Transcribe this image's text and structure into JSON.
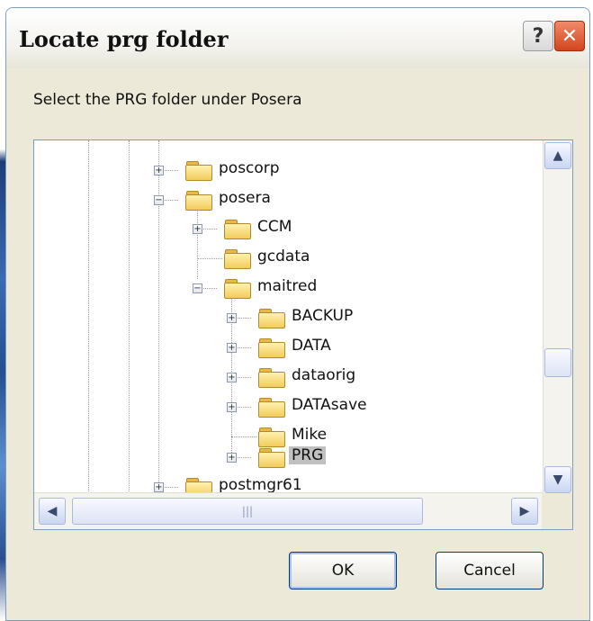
{
  "dialog": {
    "title": "Locate prg folder",
    "help_label": "?",
    "close_label": "✕",
    "instruction": "Select the PRG folder under Posera"
  },
  "tree": {
    "nodes": [
      {
        "label": "poscorp",
        "expander": "+"
      },
      {
        "label": "posera",
        "expander": "−"
      },
      {
        "label": "CCM",
        "expander": "+"
      },
      {
        "label": "gcdata",
        "expander": ""
      },
      {
        "label": "maitred",
        "expander": "−"
      },
      {
        "label": "BACKUP",
        "expander": "+"
      },
      {
        "label": "DATA",
        "expander": "+"
      },
      {
        "label": "dataorig",
        "expander": "+"
      },
      {
        "label": "DATAsave",
        "expander": "+"
      },
      {
        "label": "Mike",
        "expander": ""
      },
      {
        "label": "PRG",
        "expander": "+",
        "selected": true
      },
      {
        "label": "postmgr61",
        "expander": "+"
      }
    ]
  },
  "scrollbars": {
    "up_icon": "▲",
    "down_icon": "▼",
    "left_icon": "◀",
    "right_icon": "▶",
    "grip": "|||"
  },
  "buttons": {
    "ok_label": "OK",
    "cancel_label": "Cancel"
  }
}
